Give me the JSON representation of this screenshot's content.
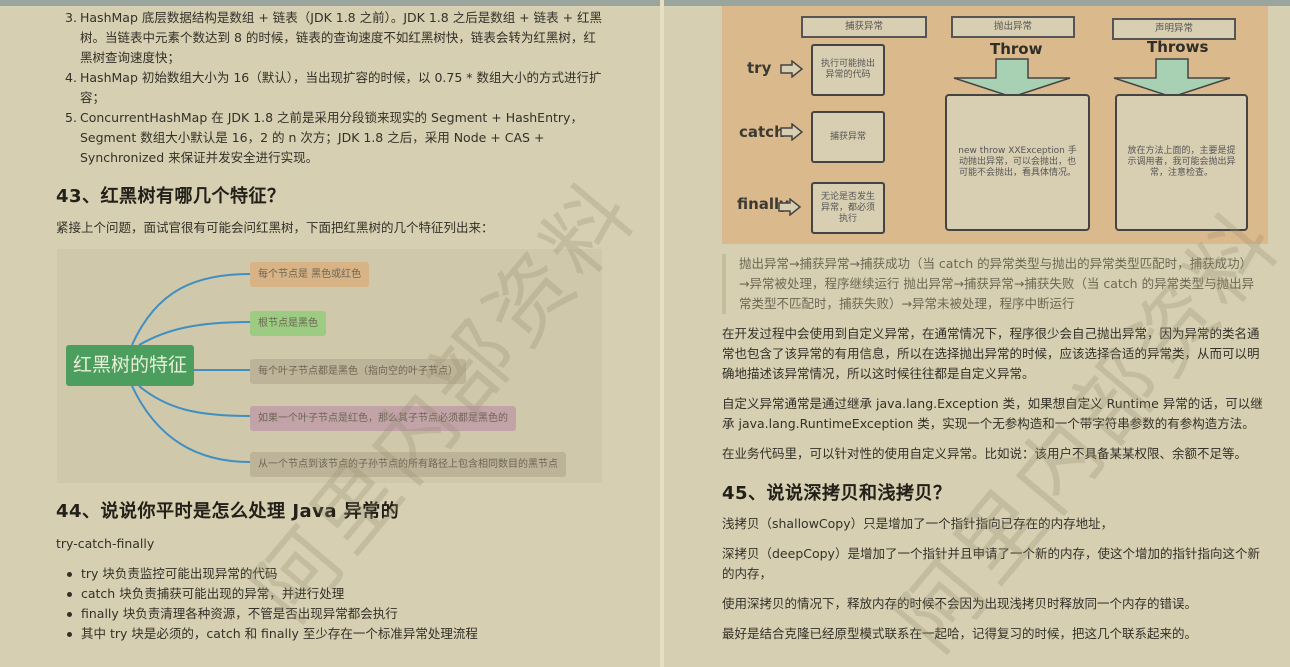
{
  "left_page": {
    "hashmap_list": [
      {
        "num": "3.",
        "text": "HashMap 底层数据结构是数组 + 链表（JDK 1.8 之前）。JDK 1.8 之后是数组 + 链表 + 红黑树。当链表中元素个数达到 8 的时候，链表的查询速度不如红黑树快，链表会转为红黑树，红黑树查询速度快；"
      },
      {
        "num": "4.",
        "text": "HashMap 初始数组大小为 16（默认），当出现扩容的时候，以 0.75 * 数组大小的方式进行扩容；"
      },
      {
        "num": "5.",
        "text": "ConcurrentHashMap 在 JDK 1.8 之前是采用分段锁来现实的 Segment + HashEntry，Segment 数组大小默认是 16，2 的 n 次方；JDK 1.8 之后，采用 Node + CAS + Synchronized 来保证并发安全进行实现。"
      }
    ],
    "q43_title": "43、红黑树有哪几个特征？",
    "q43_intro": "紧接上个问题，面试官很有可能会问红黑树，下面把红黑树的几个特征列出来：",
    "mindmap": {
      "root": "红黑树的特征",
      "line_color": "#3f8fc0",
      "nodes": [
        {
          "text": "每个节点是 黑色或红色",
          "color": "#d8b385"
        },
        {
          "text": "根节点是黑色",
          "color": "#9ccb82"
        },
        {
          "text": "每个叶子节点都是黑色（指向空的叶子节点）",
          "color": "#bdb398"
        },
        {
          "text": "如果一个叶子节点是红色，那么其子节点必须都是黑色的",
          "color": "#c1a3a8"
        },
        {
          "text": "从一个节点到该节点的子孙节点的所有路径上包含相同数目的黑节点",
          "color": "#bdb398"
        }
      ]
    },
    "q44_title": "44、说说你平时是怎么处理 Java 异常的",
    "q44_intro": "try-catch-finally",
    "q44_bullets": [
      "try 块负责监控可能出现异常的代码",
      "catch 块负责捕获可能出现的异常，并进行处理",
      "finally 块负责清理各种资源，不管是否出现异常都会执行",
      "其中 try 块是必须的，catch 和 finally 至少存在一个标准异常处理流程"
    ]
  },
  "right_page": {
    "diagram": {
      "headers": [
        "捕获异常",
        "抛出异常",
        "声明异常"
      ],
      "keywords": [
        "try",
        "catch",
        "finally"
      ],
      "small_boxes": [
        "执行可能抛出异常的代码",
        "捕获异常",
        "无论是否发生异常，都必须执行"
      ],
      "throw_title": "Throw",
      "throws_title": "Throws",
      "throw_box": "new throw XXException 手动抛出异常，可以会抛出，也可能不会抛出，看具体情况。",
      "throws_box": "放在方法上面的，主要是提示调用者，我可能会抛出异常，注意检查。",
      "arrow_color": "#a8d0b2"
    },
    "quote": "抛出异常→捕获异常→捕获成功（当 catch 的异常类型与抛出的异常类型匹配时，捕获成功）→异常被处理，程序继续运行 抛出异常→捕获异常→捕获失败（当 catch 的异常类型与抛出异常类型不匹配时，捕获失败）→异常未被处理，程序中断运行",
    "para1": "在开发过程中会使用到自定义异常，在通常情况下，程序很少会自己抛出异常，因为异常的类名通常也包含了该异常的有用信息，所以在选择抛出异常的时候，应该选择合适的异常类，从而可以明确地描述该异常情况，所以这时候往往都是自定义异常。",
    "para2": "自定义异常通常是通过继承 java.lang.Exception 类，如果想自定义 Runtime 异常的话，可以继承 java.lang.RuntimeException 类，实现一个无参构造和一个带字符串参数的有参构造方法。",
    "para3": "在业务代码里，可以针对性的使用自定义异常。比如说：该用户不具备某某权限、余额不足等。",
    "q45_title": "45、说说深拷贝和浅拷贝？",
    "q45_p1": "浅拷贝（shallowCopy）只是增加了一个指针指向已存在的内存地址，",
    "q45_p2": "深拷贝（deepCopy）是增加了一个指针并且申请了一个新的内存，使这个增加的指针指向这个新的内存，",
    "q45_p3": "使用深拷贝的情况下，释放内存的时候不会因为出现浅拷贝时释放同一个内存的错误。",
    "q45_p4": "最好是结合克隆已经原型模式联系在一起哈，记得复习的时候，把这几个联系起来的。"
  },
  "watermark": "阿里内部资料"
}
